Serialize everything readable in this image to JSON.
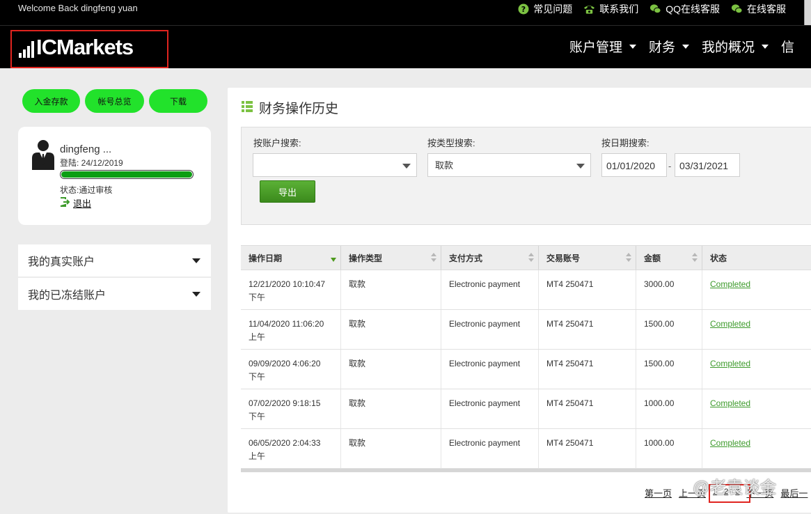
{
  "topbar": {
    "welcome": "Welcome Back dingfeng yuan",
    "links": [
      "常见问题",
      "联系我们",
      "QQ在线客服",
      "在线客服"
    ]
  },
  "brand": {
    "logo_ic": "IC",
    "logo_markets": "Markets"
  },
  "nav": {
    "items": [
      "账户管理",
      "财务",
      "我的概况",
      "信"
    ]
  },
  "left": {
    "buttons": [
      "入金存款",
      "帐号总览",
      "下载"
    ],
    "profile": {
      "name": "dingfeng ...",
      "login_label": "登陆: 24/12/2019",
      "progress_percent": 100,
      "status": "状态:通过审核",
      "logout": "退出"
    },
    "accounts": [
      "我的真实账户",
      "我的已冻结账户"
    ]
  },
  "panel": {
    "title": "财务操作历史",
    "search": {
      "account_label": "按账户搜索:",
      "account_value": "",
      "type_label": "按类型搜索:",
      "type_value": "取款",
      "date_label": "按日期搜索:",
      "date_from": "01/01/2020",
      "date_sep": "-",
      "date_to": "03/31/2021",
      "export": "导出"
    },
    "table": {
      "headers": [
        "操作日期",
        "操作类型",
        "支付方式",
        "交易账号",
        "金额",
        "状态"
      ],
      "rows": [
        {
          "date": "12/21/2020 10:10:47",
          "ampm": "下午",
          "type": "取款",
          "method": "Electronic payment",
          "account": "MT4 250471",
          "amount": "3000.00",
          "status": "Completed"
        },
        {
          "date": "11/04/2020 11:06:20",
          "ampm": "上午",
          "type": "取款",
          "method": "Electronic payment",
          "account": "MT4 250471",
          "amount": "1500.00",
          "status": "Completed"
        },
        {
          "date": "09/09/2020 4:06:20",
          "ampm": "下午",
          "type": "取款",
          "method": "Electronic payment",
          "account": "MT4 250471",
          "amount": "1500.00",
          "status": "Completed"
        },
        {
          "date": "07/02/2020 9:18:15",
          "ampm": "下午",
          "type": "取款",
          "method": "Electronic payment",
          "account": "MT4 250471",
          "amount": "1000.00",
          "status": "Completed"
        },
        {
          "date": "06/05/2020 2:04:33",
          "ampm": "上午",
          "type": "取款",
          "method": "Electronic payment",
          "account": "MT4 250471",
          "amount": "1000.00",
          "status": "Completed"
        }
      ]
    },
    "pager": {
      "first": "第一页",
      "prev": "上一页",
      "pages": [
        "1",
        "2",
        "3"
      ],
      "next": "下一页",
      "last": "最后一"
    }
  },
  "watermark": "@老袁谈金",
  "colors": {
    "accent_green": "#22e22b",
    "link_green": "#3c9a2a",
    "highlight_red": "#e0241f"
  }
}
